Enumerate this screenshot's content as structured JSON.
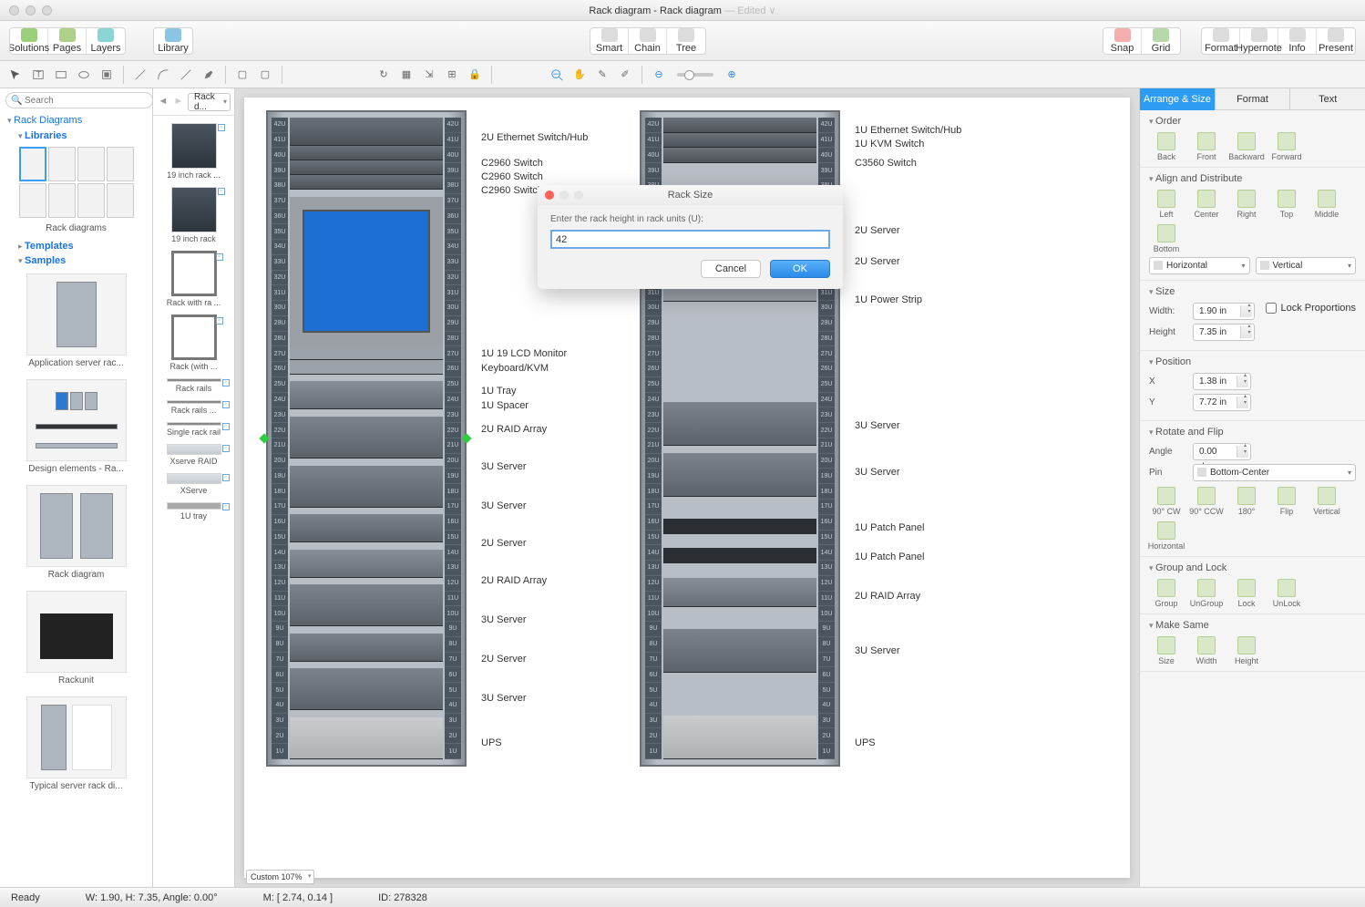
{
  "window": {
    "title": "Rack diagram - Rack diagram",
    "edited": "— Edited ∨"
  },
  "maintoolbar": {
    "left": [
      "Solutions",
      "Pages",
      "Layers",
      "Library"
    ],
    "center": [
      "Smart",
      "Chain",
      "Tree"
    ],
    "right1": [
      "Snap",
      "Grid"
    ],
    "right2": [
      "Format",
      "Hypernote",
      "Info",
      "Present"
    ]
  },
  "search": {
    "placeholder": "Search"
  },
  "tree": {
    "root": "Rack Diagrams",
    "libs": "Libraries",
    "rackdiagrams": "Rack diagrams",
    "templates": "Templates",
    "samples": "Samples"
  },
  "samples": [
    "Application server rac...",
    "Design elements - Ra...",
    "Rack diagram",
    "Rackunit",
    "Typical server rack di..."
  ],
  "shapesTop": "Rack d...",
  "shapes": [
    "19 inch rack ...",
    "19 inch rack",
    "Rack with ra ...",
    "Rack (with ...",
    "Rack rails",
    "Rack rails ...",
    "Single rack rail",
    "Xserve RAID",
    "XServe",
    "1U tray"
  ],
  "zoom": "Custom 107%",
  "dialog": {
    "title": "Rack Size",
    "prompt": "Enter the rack height in rack units (U):",
    "value": "42",
    "cancel": "Cancel",
    "ok": "OK"
  },
  "insp": {
    "tabs": [
      "Arrange & Size",
      "Format",
      "Text"
    ],
    "order": {
      "h": "Order",
      "btns": [
        "Back",
        "Front",
        "Backward",
        "Forward"
      ]
    },
    "align": {
      "h": "Align and Distribute",
      "btns": [
        "Left",
        "Center",
        "Right",
        "Top",
        "Middle",
        "Bottom"
      ],
      "sel": [
        "Horizontal",
        "Vertical"
      ]
    },
    "size": {
      "h": "Size",
      "width_l": "Width:",
      "width_v": "1.90 in",
      "height_l": "Height",
      "height_v": "7.35 in",
      "lock": "Lock Proportions"
    },
    "pos": {
      "h": "Position",
      "x_l": "X",
      "x_v": "1.38 in",
      "y_l": "Y",
      "y_v": "7.72 in"
    },
    "rot": {
      "h": "Rotate and Flip",
      "angle_l": "Angle",
      "angle_v": "0.00 deg",
      "pin_l": "Pin",
      "pin_v": "Bottom-Center",
      "btns": [
        "90° CW",
        "90° CCW",
        "180°",
        "Flip",
        "Vertical",
        "Horizontal"
      ]
    },
    "grp": {
      "h": "Group and Lock",
      "btns": [
        "Group",
        "UnGroup",
        "Lock",
        "UnLock"
      ]
    },
    "same": {
      "h": "Make Same",
      "btns": [
        "Size",
        "Width",
        "Height"
      ]
    }
  },
  "rackLabelsLeft": [
    {
      "t": 20,
      "txt": "2U Ethernet Switch/Hub"
    },
    {
      "t": 48,
      "txt": "C2960 Switch"
    },
    {
      "t": 63,
      "txt": "C2960 Switch"
    },
    {
      "t": 78,
      "txt": "C2960 Switch"
    },
    {
      "t": 257,
      "txt": "1U 19 LCD Monitor"
    },
    {
      "t": 273,
      "txt": "Keyboard/KVM"
    },
    {
      "t": 298,
      "txt": "1U Tray"
    },
    {
      "t": 314,
      "txt": "1U Spacer"
    },
    {
      "t": 340,
      "txt": "2U RAID Array"
    },
    {
      "t": 381,
      "txt": "3U Server"
    },
    {
      "t": 424,
      "txt": "3U Server"
    },
    {
      "t": 465,
      "txt": "2U Server"
    },
    {
      "t": 506,
      "txt": "2U RAID Array"
    },
    {
      "t": 549,
      "txt": "3U Server"
    },
    {
      "t": 592,
      "txt": "2U Server"
    },
    {
      "t": 635,
      "txt": "3U Server"
    },
    {
      "t": 684,
      "txt": "UPS"
    }
  ],
  "rackLabelsRight": [
    {
      "t": 12,
      "txt": "1U Ethernet Switch/Hub"
    },
    {
      "t": 27,
      "txt": "1U KVM Switch"
    },
    {
      "t": 48,
      "txt": "C3560 Switch"
    },
    {
      "t": 122,
      "txt": "2U Server"
    },
    {
      "t": 156,
      "txt": "2U Server"
    },
    {
      "t": 198,
      "txt": "1U Power Strip"
    },
    {
      "t": 336,
      "txt": "3U Server"
    },
    {
      "t": 387,
      "txt": "3U Server"
    },
    {
      "t": 448,
      "txt": "1U Patch Panel"
    },
    {
      "t": 480,
      "txt": "1U Patch Panel"
    },
    {
      "t": 523,
      "txt": "2U RAID Array"
    },
    {
      "t": 583,
      "txt": "3U Server"
    },
    {
      "t": 684,
      "txt": "UPS"
    }
  ],
  "status": {
    "ready": "Ready",
    "wh": "W: 1.90,  H: 7.35,  Angle: 0.00°",
    "m": "M: [ 2.74, 0.14 ]",
    "id": "ID: 278328"
  }
}
